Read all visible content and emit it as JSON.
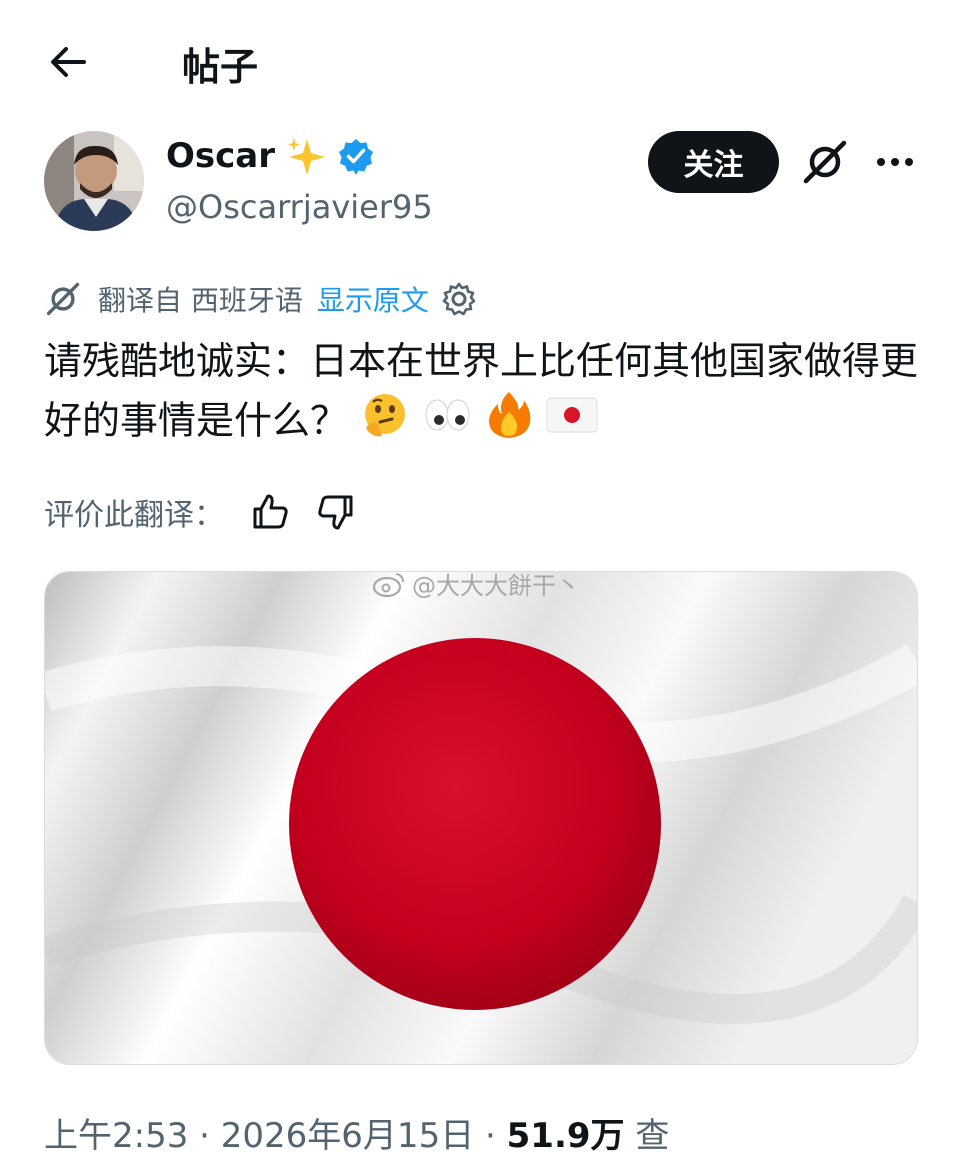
{
  "header": {
    "title": "帖子",
    "back_icon": "arrow-left-icon"
  },
  "author": {
    "name": "Oscar",
    "handle": "@Oscarrjavier95",
    "badge_icons": [
      "sparkles-icon",
      "verified-badge-icon"
    ],
    "verified_color": "#1d9bf0"
  },
  "actions": {
    "follow_label": "关注",
    "grok_icon": "grok-icon",
    "more_icon": "more-icon"
  },
  "translation": {
    "prefix": "翻译自 西班牙语",
    "show_original": "显示原文",
    "settings_icon": "gear-icon"
  },
  "post": {
    "text": "请残酷地诚实：日本在世界上比任何其他国家做得更好的事情是什么？",
    "emojis": [
      "thinking-face-emoji",
      "eyes-emoji",
      "fire-emoji",
      "japan-flag-emoji"
    ]
  },
  "rating": {
    "label": "评价此翻译：",
    "like_icon": "thumbs-up-icon",
    "dislike_icon": "thumbs-down-icon"
  },
  "media": {
    "description_icon": "japan-flag-image",
    "watermark": "@大大大餅干丶",
    "flag_red": "#c4001e"
  },
  "footer": {
    "time": "上午2:53 · 2026年6月15日 · ",
    "views": "51.9万",
    "views_suffix": " 查"
  }
}
